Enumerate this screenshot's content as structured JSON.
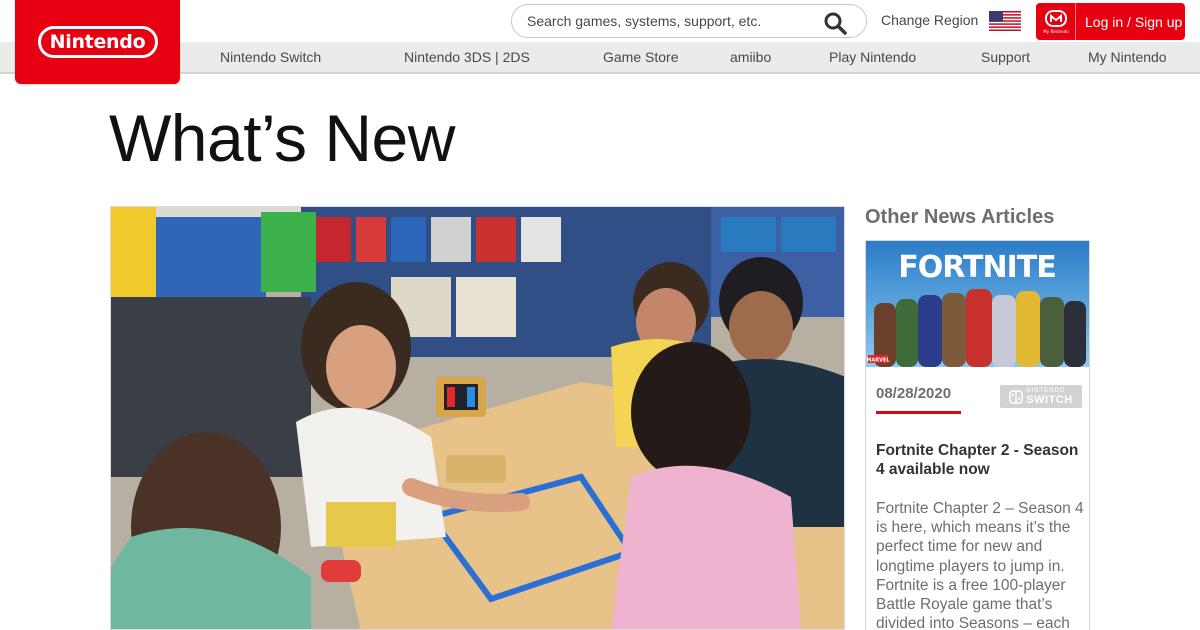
{
  "brand": {
    "logo_text": "Nintendo"
  },
  "header": {
    "search": {
      "placeholder": "Search games, systems, support, etc."
    },
    "change_region": "Change Region",
    "login_label": "Log in / Sign up",
    "login_icon_caption": "My Nintendo"
  },
  "nav": {
    "items": [
      {
        "label": "Nintendo Switch"
      },
      {
        "label": "Nintendo 3DS | 2DS"
      },
      {
        "label": "Game Store"
      },
      {
        "label": "amiibo"
      },
      {
        "label": "Play Nintendo"
      },
      {
        "label": "Support"
      },
      {
        "label": "My Nintendo"
      }
    ]
  },
  "main": {
    "title": "What’s New"
  },
  "sidebar": {
    "title": "Other News Articles",
    "article": {
      "thumbnail_title": "FORTNITE",
      "thumbnail_badge": "MARVEL",
      "date": "08/28/2020",
      "platform_top": "NINTENDO",
      "platform": "SWITCH",
      "headline": "Fortnite Chapter 2 - Season 4 available now",
      "body": "Fortnite Chapter 2 – Season 4 is here, which means it’s the perfect time for new and longtime players to jump in. Fortnite is a free 100-player Battle Royale game that’s divided into Seasons – each"
    }
  },
  "colors": {
    "brand_red": "#e60012",
    "nav_bg": "#ebebeb",
    "text": "#484848"
  }
}
